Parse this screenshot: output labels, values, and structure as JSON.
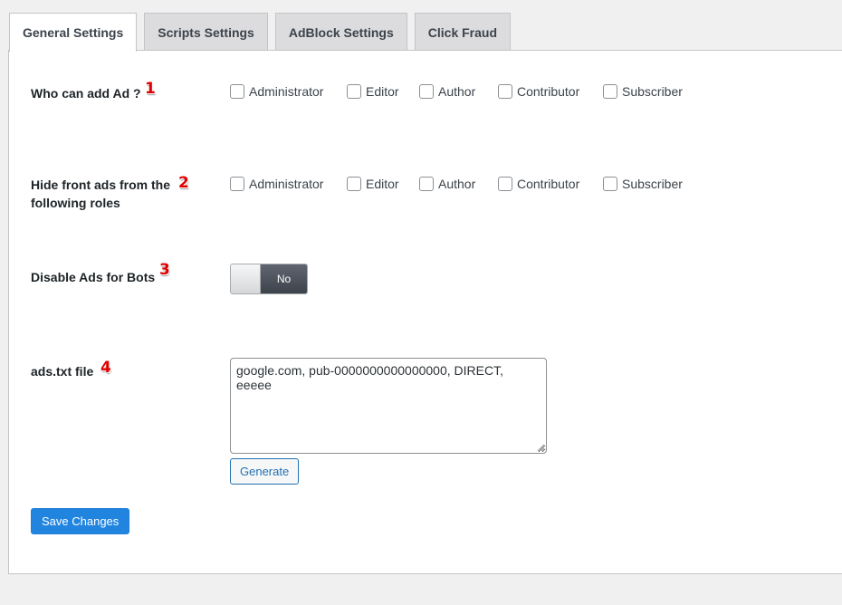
{
  "tabs": [
    {
      "label": "General Settings",
      "active": true
    },
    {
      "label": "Scripts Settings",
      "active": false
    },
    {
      "label": "AdBlock Settings",
      "active": false
    },
    {
      "label": "Click Fraud",
      "active": false
    }
  ],
  "settings": {
    "who_can_add": {
      "label": "Who can add Ad ?",
      "marker": "1",
      "roles": [
        "Administrator",
        "Editor",
        "Author",
        "Contributor",
        "Subscriber"
      ]
    },
    "hide_front_ads": {
      "label_line1": "Hide front ads from the",
      "label_line2": "following roles",
      "marker": "2",
      "roles": [
        "Administrator",
        "Editor",
        "Author",
        "Contributor",
        "Subscriber"
      ]
    },
    "disable_bots": {
      "label": "Disable Ads for Bots",
      "marker": "3",
      "toggle_text": "No",
      "enabled": false
    },
    "ads_txt": {
      "label": "ads.txt file",
      "marker": "4",
      "value": "google.com, pub-0000000000000000, DIRECT, eeeee",
      "generate_label": "Generate"
    }
  },
  "save_label": "Save Changes",
  "colors": {
    "accent": "#2271b1",
    "marker": "#e00000",
    "background": "#f0f0f1"
  }
}
